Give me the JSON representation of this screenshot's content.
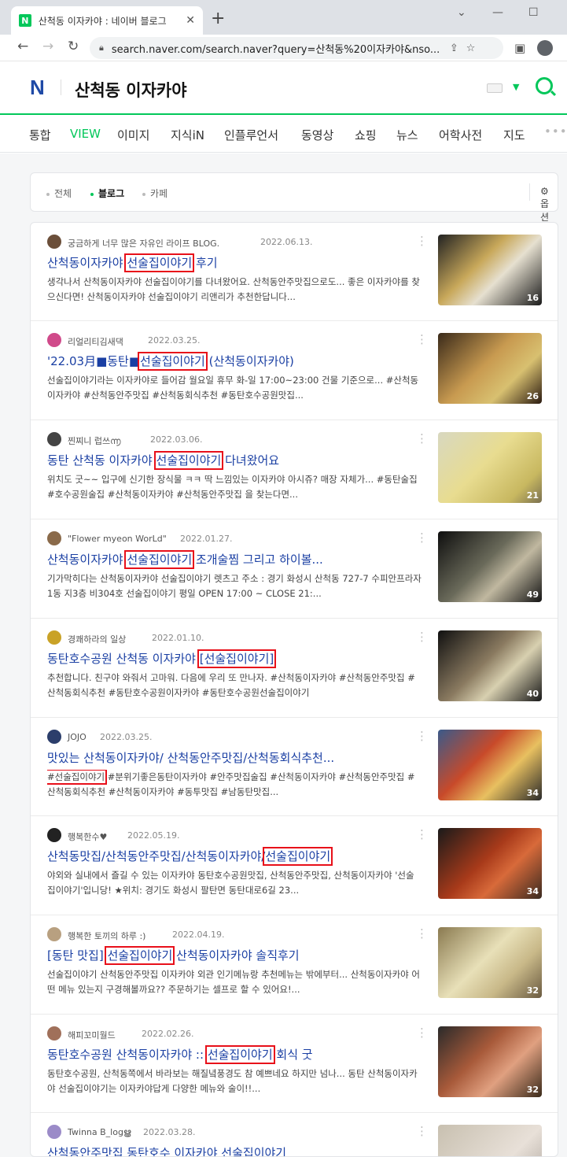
{
  "browser": {
    "tab_title": "산척동 이자카야 : 네이버 블로그",
    "tab_favicon": "N",
    "new_tab": "+",
    "url": "search.naver.com/search.naver?query=산척동%20이자카야&nso...",
    "icons": [
      "back-icon",
      "forward-icon",
      "reload-icon",
      "lock-icon",
      "share-icon",
      "star-icon",
      "sidepanel-icon",
      "profile-icon"
    ]
  },
  "header": {
    "logo": "N",
    "query": "산척동 이자카야",
    "accent": "#03c75a"
  },
  "categories": [
    {
      "label": "통합",
      "active": false
    },
    {
      "label": "VIEW",
      "active": true
    },
    {
      "label": "이미지",
      "active": false
    },
    {
      "label": "지식iN",
      "active": false
    },
    {
      "label": "인플루언서",
      "active": false
    },
    {
      "label": "동영상",
      "active": false
    },
    {
      "label": "쇼핑",
      "active": false
    },
    {
      "label": "뉴스",
      "active": false
    },
    {
      "label": "어학사전",
      "active": false
    },
    {
      "label": "지도",
      "active": false
    }
  ],
  "more_label": "•••",
  "filters": {
    "all": "전체",
    "blog": "블로그",
    "cafe": "카페",
    "options": "옵션"
  },
  "results": [
    {
      "author": "궁금하게 너무 많은 자유인 라이프 BLOG.",
      "date": "2022.06.13.",
      "title_pre": "산척동이자카야 ",
      "title_hl": "선술집이야기",
      "title_post": " 후기",
      "desc": "생각나서 산척동이자카야 선술집이야기를 다녀왔어요. 산척동안주맛집으로도... 좋은 이자카야를 찾으신다면! 산척동이자카야 선술집이야기 리앤리가 추천한답니다...",
      "count": "16"
    },
    {
      "author": "리얼리티김새댁",
      "date": "2022.03.25.",
      "title_pre": "'22.03月■동탄■",
      "title_hl": "선술집이야기",
      "title_post": " (산척동이자카야)",
      "desc": "선술집이야기라는 이자카야로 들어감 월요일 휴무 화-일 17:00~23:00 건물 기준으로... #산척동이자카야 #산척동안주맛집 #산척동회식추천 #동탄호수공원맛집...",
      "count": "26"
    },
    {
      "author": "찐찌니 럽쓰൬",
      "date": "2022.03.06.",
      "title_pre": "동탄 산척동 이자카야 ",
      "title_hl": "선술집이야기",
      "title_post": " 다녀왔어요",
      "desc": "위치도 굿~~ 입구에 신기한 장식물 ㅋㅋ 딱 느낌있는 이자카야 아시쥬? 매장 자체가... #동탄술집 #호수공원술집 #산척동이자카야 #산척동안주맛집 을 찾는다면...",
      "count": "21"
    },
    {
      "author": "\"Flower myeon WorLd\"",
      "date": "2022.01.27.",
      "title_pre": "산척동이자카야 ",
      "title_hl": "선술집이야기",
      "title_post": " 조개술찜 그리고 하이볼...",
      "desc": "기가막히다는 산척동이자카야 선술집이야기 렛츠고 주소 : 경기 화성시 산척동 727-7 수피안프라자 1동 지3층 비304호 선술집이야기 평일 OPEN 17:00 ~ CLOSE 21:...",
      "count": "49"
    },
    {
      "author": "경쾌하라의 일상",
      "date": "2022.01.10.",
      "title_pre": "동탄호수공원 산척동 이자카야 ",
      "title_hl": "[선술집이야기]",
      "title_post": "",
      "desc": "추천합니다. 친구야 와줘서 고마워. 다음에 우리 또 만나자. #산척동이자카야 #산척동안주맛집 #산척동회식추천 #동탄호수공원이자카야 #동탄호수공원선술집이야기",
      "count": "40"
    },
    {
      "author": "JOJO",
      "date": "2022.03.25.",
      "title_pre": "맛있는 산척동이자카야/ 산척동안주맛집/산척동회식추천...",
      "title_hl": "",
      "title_post": "",
      "desc_hl": "#선술집이야기",
      "desc": " #분위기좋은동탄이자카야 #안주맛집술집 #산척동이자카야 #산척동안주맛집 #산척동회식추천 #산척동이자카야 #동투맛집 #남동탄맛집...",
      "count": "34"
    },
    {
      "author": "행복한수♥",
      "date": "2022.05.19.",
      "title_pre": "산척동맛집/산척동안주맛집/산척동이자카야/",
      "title_hl": "선술집이야기",
      "title_post": "",
      "desc": "야외와 실내에서 즐길 수 있는 이자카야 동탄호수공원맛집, 산척동안주맛집, 산척동이자카야 '선술집이야기'입니당! ★위치: 경기도 화성시 팔탄면 동탄대로6길 23...",
      "count": "34"
    },
    {
      "author": "행복한 토끼의 하루 :)",
      "date": "2022.04.19.",
      "title_pre": "[동탄 맛집] ",
      "title_hl": "선술집이야기",
      "title_post": " 산척동이자카야 솔직후기",
      "desc": "선술집이야기 산척동안주맛집 이자카야 외관 인기메뉴랑 추천메뉴는 밖에부터... 산척동이자카야 어떤 메뉴 있는지 구경해볼까요?? 주문하기는 셀프로 할 수 있어요!...",
      "count": "32"
    },
    {
      "author": "해피꼬미월드",
      "date": "2022.02.26.",
      "title_pre": "동탄호수공원 산척동이자카야 :: ",
      "title_hl": "선술집이야기",
      "title_post": " 회식 굿",
      "desc": "동탄호수공원, 산척동쪽에서 바라보는 해질녘풍경도 참 예쁘네요 하지만 넘나... 동탄 산척동이자카야 선술집이야기는 이자카야답게 다양한 메뉴와 술이!!...",
      "count": "32"
    },
    {
      "author": "Twinna B_logൠ",
      "date": "2022.03.28.",
      "title_pre": "산척동안주맛집 동탄호수 이자카야 선술집이야기",
      "title_hl": "",
      "title_post": "",
      "desc": "",
      "count": ""
    }
  ]
}
